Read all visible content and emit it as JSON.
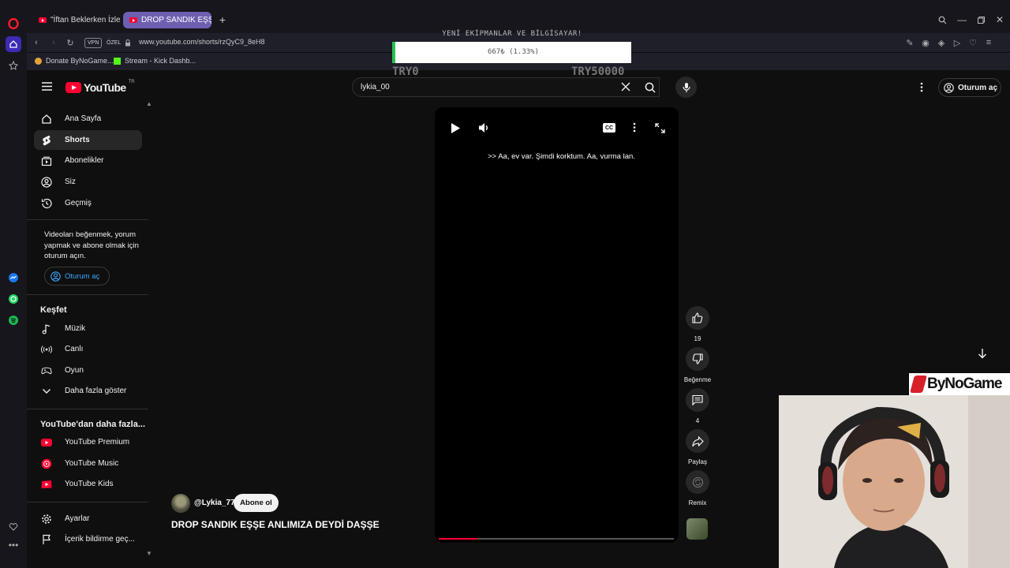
{
  "browser": {
    "tabs": [
      {
        "label": "\"İftan Beklerken İzlemelik"
      },
      {
        "label": "DROP SANDIK EŞŞE ANLIMIZA"
      }
    ],
    "url": "www.youtube.com/shorts/rzQyC9_8eH8",
    "vpn_label": "VPN",
    "private_label": "ÖZEL",
    "bookmarks": [
      {
        "label": "Donate ByNoGame..."
      },
      {
        "label": "Stream - Kick Dashb..."
      }
    ]
  },
  "overlay": {
    "title": "YENİ EKİPMANLAR VE BİLGİSAYAR!",
    "progress_text": "667₺ (1.33%)",
    "progress_fraction": 0.0133,
    "min_label": "TRY0",
    "max_label": "TRY50000",
    "accent": "#29c24a"
  },
  "youtube": {
    "logo_text": "YouTube",
    "region": "TR",
    "search_value": "lykia_00",
    "signin_label": "Oturum aç",
    "guide": {
      "main": [
        {
          "label": "Ana Sayfa",
          "icon": "home-icon"
        },
        {
          "label": "Shorts",
          "icon": "shorts-icon"
        },
        {
          "label": "Abonelikler",
          "icon": "subscriptions-icon"
        },
        {
          "label": "Siz",
          "icon": "user-icon"
        },
        {
          "label": "Geçmiş",
          "icon": "history-icon"
        }
      ],
      "signin_prompt": "Videoları beğenmek, yorum yapmak ve abone olmak için oturum açın.",
      "signin_button": "Oturum aç",
      "explore_heading": "Keşfet",
      "explore": [
        {
          "label": "Müzik",
          "icon": "music-icon"
        },
        {
          "label": "Canlı",
          "icon": "live-icon"
        },
        {
          "label": "Oyun",
          "icon": "gaming-icon"
        },
        {
          "label": "Daha fazla göster",
          "icon": "chevron-down-icon"
        }
      ],
      "more_heading": "YouTube'dan daha fazla...",
      "more": [
        {
          "label": "YouTube Premium"
        },
        {
          "label": "YouTube Music"
        },
        {
          "label": "YouTube Kids"
        }
      ],
      "bottom": [
        {
          "label": "Ayarlar",
          "icon": "gear-icon"
        },
        {
          "label": "İçerik bildirme geç...",
          "icon": "flag-icon"
        }
      ]
    },
    "player": {
      "caption": ">> Aa, ev var. Şimdi korktum. Aa, vurma lan.",
      "progress_fraction": 0.165
    },
    "actions": {
      "likes": "19",
      "dislike_label": "Beğenme",
      "comments": "4",
      "share_label": "Paylaş",
      "remix_label": "Remix"
    },
    "channel": "@Lykia_77",
    "subscribe_label": "Abone ol",
    "title": "DROP SANDIK EŞŞE ANLIMIZA DEYDİ DAŞŞE"
  },
  "stream": {
    "logo_text": "ByNoGame",
    "brand_color": "#d8202a"
  }
}
